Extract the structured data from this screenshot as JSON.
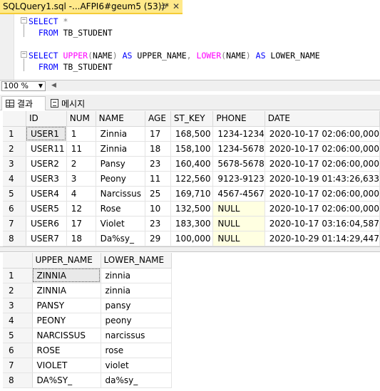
{
  "tab": {
    "title": "SQLQuery1.sql -...AFPI6#geum5 (53))*",
    "pin": "⊅",
    "close": "✕"
  },
  "editor": {
    "lines": [
      {
        "parts": [
          {
            "t": "SELECT",
            "c": "kw"
          },
          {
            "t": " ",
            "c": "tx"
          },
          {
            "t": "*",
            "c": "op"
          }
        ]
      },
      {
        "parts": [
          {
            "t": "  FROM",
            "c": "kw"
          },
          {
            "t": " TB_STUDENT",
            "c": "tx"
          }
        ]
      },
      {
        "parts": []
      },
      {
        "parts": [
          {
            "t": "SELECT",
            "c": "kw"
          },
          {
            "t": " ",
            "c": "tx"
          },
          {
            "t": "UPPER",
            "c": "fn"
          },
          {
            "t": "(",
            "c": "op"
          },
          {
            "t": "NAME",
            "c": "tx"
          },
          {
            "t": ")",
            "c": "op"
          },
          {
            "t": " AS",
            "c": "kw"
          },
          {
            "t": " UPPER_NAME",
            "c": "tx"
          },
          {
            "t": ",",
            "c": "op"
          },
          {
            "t": " ",
            "c": "tx"
          },
          {
            "t": "LOWER",
            "c": "fn"
          },
          {
            "t": "(",
            "c": "op"
          },
          {
            "t": "NAME",
            "c": "tx"
          },
          {
            "t": ")",
            "c": "op"
          },
          {
            "t": " AS",
            "c": "kw"
          },
          {
            "t": " LOWER_NAME",
            "c": "tx"
          }
        ]
      },
      {
        "parts": [
          {
            "t": "  FROM",
            "c": "kw"
          },
          {
            "t": " TB_STUDENT",
            "c": "tx"
          }
        ]
      }
    ]
  },
  "zoom": {
    "value": "100 %"
  },
  "result_tabs": {
    "results": "결과",
    "messages": "메시지"
  },
  "grid1": {
    "columns": [
      "ID",
      "NUM",
      "NAME",
      "AGE",
      "ST_KEY",
      "PHONE",
      "DATE"
    ],
    "rows": [
      [
        "1",
        "USER1",
        "1",
        "Zinnia",
        "17",
        "168,500",
        "1234-1234",
        "2020-10-17 02:06:00,000"
      ],
      [
        "2",
        "USER11",
        "11",
        "Zinnia",
        "18",
        "158,100",
        "1234-5678",
        "2020-10-17 02:06:00,000"
      ],
      [
        "3",
        "USER2",
        "2",
        "Pansy",
        "23",
        "160,400",
        "5678-5678",
        "2020-10-17 02:06:00,000"
      ],
      [
        "4",
        "USER3",
        "3",
        "Peony",
        "11",
        "122,560",
        "9123-9123",
        "2020-10-19 01:43:26,633"
      ],
      [
        "5",
        "USER4",
        "4",
        "Narcissus",
        "25",
        "169,710",
        "4567-4567",
        "2020-10-17 02:06:00,000"
      ],
      [
        "6",
        "USER5",
        "12",
        "Rose",
        "10",
        "132,500",
        "NULL",
        "2020-10-17 02:06:00,000"
      ],
      [
        "7",
        "USER6",
        "17",
        "Violet",
        "23",
        "183,300",
        "NULL",
        "2020-10-17 03:16:04,587"
      ],
      [
        "8",
        "USER7",
        "18",
        "Da%sy_",
        "29",
        "100,000",
        "NULL",
        "2020-10-29 01:14:29,447"
      ]
    ]
  },
  "grid2": {
    "columns": [
      "UPPER_NAME",
      "LOWER_NAME"
    ],
    "rows": [
      [
        "1",
        "ZINNIA",
        "zinnia"
      ],
      [
        "2",
        "ZINNIA",
        "zinnia"
      ],
      [
        "3",
        "PANSY",
        "pansy"
      ],
      [
        "4",
        "PEONY",
        "peony"
      ],
      [
        "5",
        "NARCISSUS",
        "narcissus"
      ],
      [
        "6",
        "ROSE",
        "rose"
      ],
      [
        "7",
        "VIOLET",
        "violet"
      ],
      [
        "8",
        "DA%SY_",
        "da%sy_"
      ]
    ]
  }
}
